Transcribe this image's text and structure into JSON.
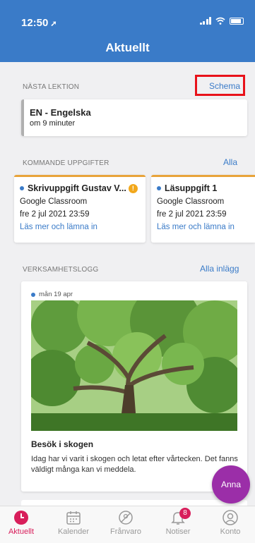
{
  "status_bar": {
    "time": "12:50"
  },
  "header": {
    "title": "Aktuellt"
  },
  "next_lesson": {
    "section_label": "NÄSTA LEKTION",
    "link": "Schema",
    "title": "EN - Engelska",
    "subtitle": "om 9 minuter"
  },
  "upcoming": {
    "section_label": "KOMMANDE UPPGIFTER",
    "link": "Alla",
    "tasks": [
      {
        "title": "Skrivuppgift Gustav V...",
        "source": "Google Classroom",
        "due": "fre 2 jul 2021 23:59",
        "link": "Läs mer och lämna in"
      },
      {
        "title": "Läsuppgift 1",
        "source": "Google Classroom",
        "due": "fre 2 jul 2021 23:59",
        "link": "Läs mer och lämna in"
      }
    ]
  },
  "activity_log": {
    "section_label": "VERKSAMHETSLOGG",
    "link": "Alla inlägg",
    "post": {
      "date": "mån 19 apr",
      "title": "Besök i skogen",
      "text": "Idag har vi varit i skogen och letat efter vårtecken. Det fanns väldigt många kan vi meddela."
    }
  },
  "fab": {
    "label": "Anna"
  },
  "tabbar": {
    "items": [
      {
        "label": "Aktuellt",
        "icon": "clock-icon"
      },
      {
        "label": "Kalender",
        "icon": "calendar-icon"
      },
      {
        "label": "Frånvaro",
        "icon": "absence-icon"
      },
      {
        "label": "Notiser",
        "icon": "bell-icon",
        "badge": "8"
      },
      {
        "label": "Konto",
        "icon": "user-icon"
      }
    ]
  },
  "colors": {
    "accent": "#3a7bc8",
    "active_tab": "#d81e5b",
    "fab": "#9b2ea8",
    "highlight": "#e8121a"
  }
}
